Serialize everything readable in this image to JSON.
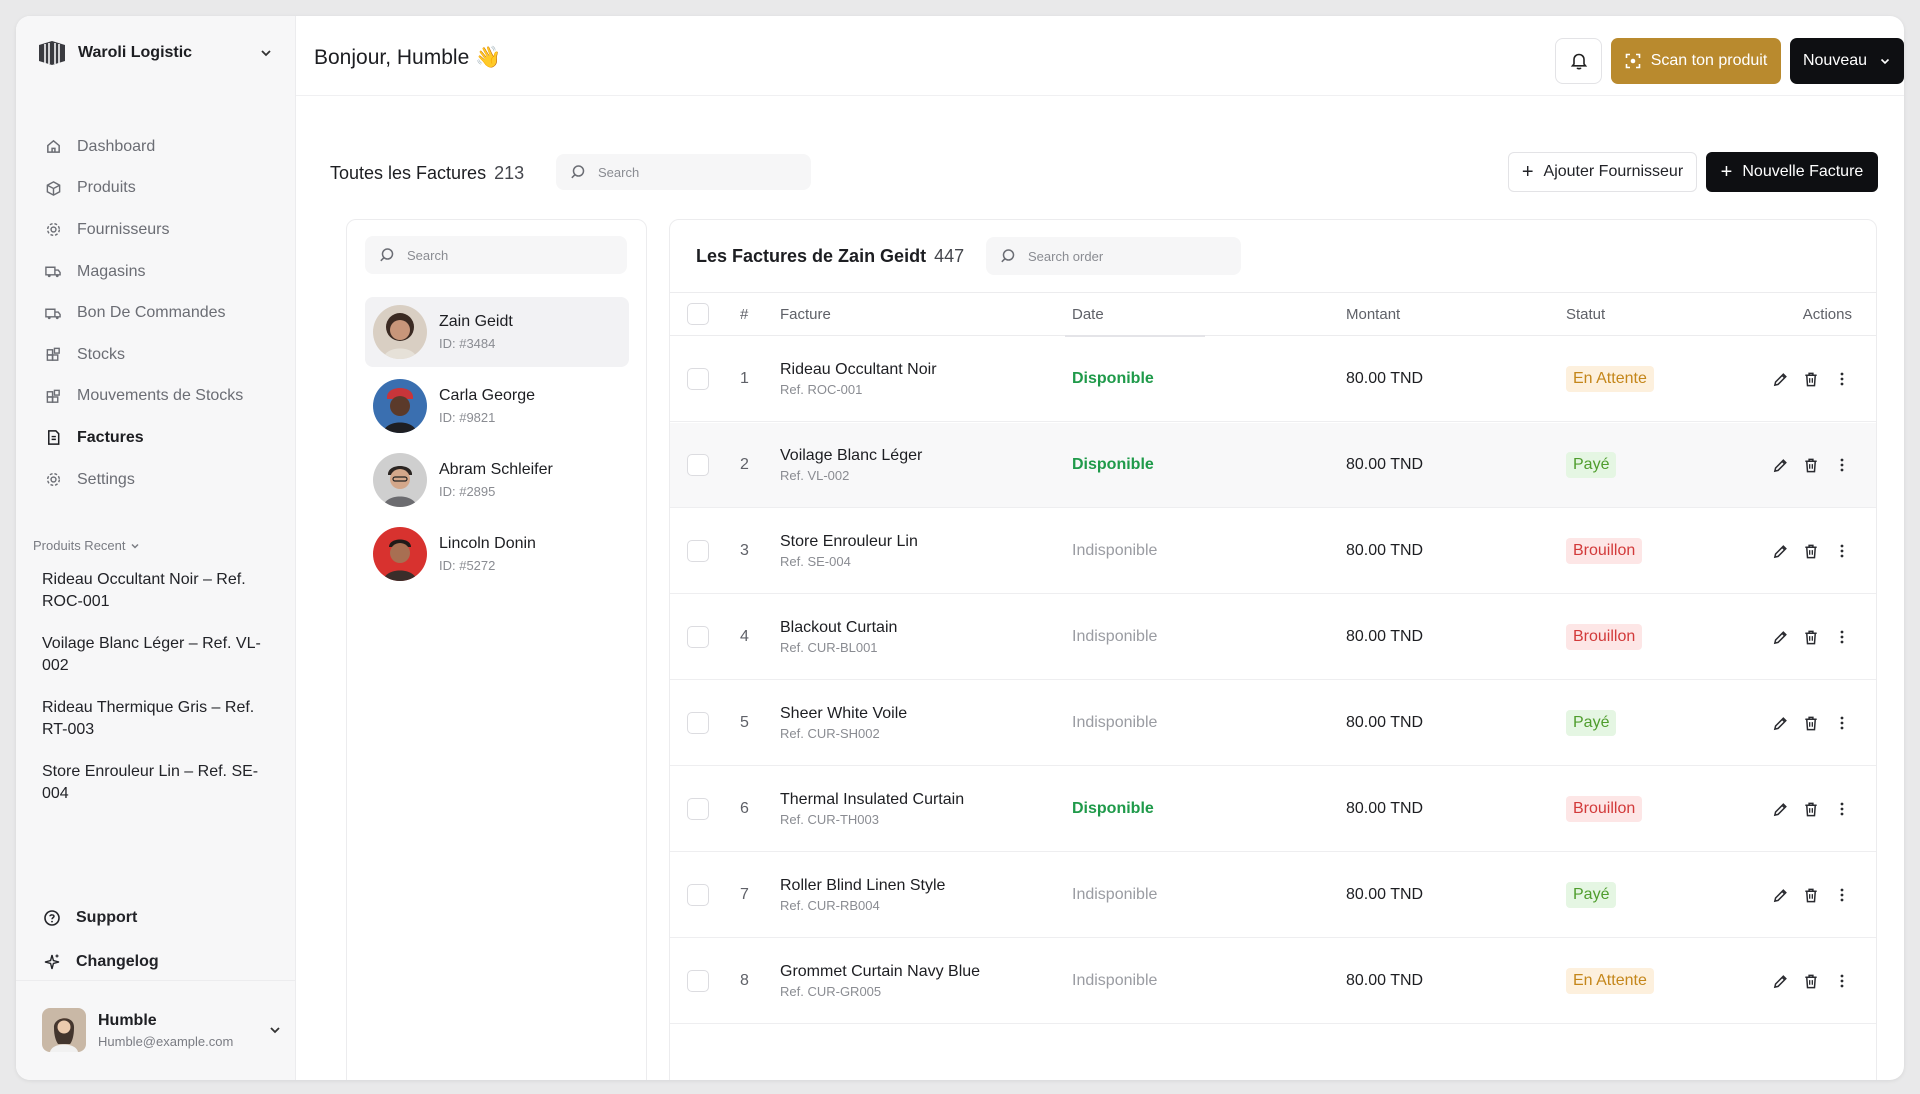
{
  "brand": {
    "name": "Waroli Logistic"
  },
  "sidebar": {
    "items": [
      {
        "label": "Dashboard",
        "icon": "home-icon",
        "active": false
      },
      {
        "label": "Produits",
        "icon": "box-icon",
        "active": false
      },
      {
        "label": "Fournisseurs",
        "icon": "gear-icon",
        "active": false
      },
      {
        "label": "Magasins",
        "icon": "truck-icon",
        "active": false
      },
      {
        "label": "Bon De Commandes",
        "icon": "truck-icon",
        "active": false
      },
      {
        "label": "Stocks",
        "icon": "grid-icon",
        "active": false
      },
      {
        "label": "Mouvements de Stocks",
        "icon": "grid-icon",
        "active": false
      },
      {
        "label": "Factures",
        "icon": "invoice-icon",
        "active": true
      },
      {
        "label": "Settings",
        "icon": "gear-icon",
        "active": false
      }
    ],
    "recent_title": "Produits Recent",
    "recent": [
      "Rideau Occultant Noir – Ref. ROC-001",
      "Voilage Blanc Léger – Ref. VL-002",
      "Rideau Thermique Gris – Ref. RT-003",
      "Store Enrouleur Lin – Ref. SE-004"
    ],
    "bottom": [
      {
        "label": "Support",
        "icon": "help-icon"
      },
      {
        "label": "Changelog",
        "icon": "sparkle-icon"
      }
    ],
    "user": {
      "name": "Humble",
      "email": "Humble@example.com"
    }
  },
  "header": {
    "greeting": "Bonjour, Humble 👋",
    "scan_label": "Scan ton produit",
    "new_label": "Nouveau"
  },
  "main": {
    "title": "Toutes les Factures",
    "count": "213",
    "search_placeholder": "Search",
    "add_supplier_label": "Ajouter Fournisseur",
    "new_invoice_label": "Nouvelle Facture"
  },
  "suppliers": {
    "search_placeholder": "Search",
    "items": [
      {
        "name": "Zain Geidt",
        "id": "ID: #3484",
        "active": true
      },
      {
        "name": "Carla George",
        "id": "ID: #9821",
        "active": false
      },
      {
        "name": "Abram Schleifer",
        "id": "ID: #2895",
        "active": false
      },
      {
        "name": "Lincoln Donin",
        "id": "ID: #5272",
        "active": false
      }
    ]
  },
  "invoices": {
    "title": "Les Factures de Zain Geidt",
    "count": "447",
    "search_placeholder": "Search order",
    "columns": [
      "#",
      "Facture",
      "Date",
      "Montant",
      "Statut",
      "Actions"
    ],
    "rows": [
      {
        "num": "1",
        "name": "Rideau Occultant Noir",
        "ref": "Ref. ROC-001",
        "date": "Disponible",
        "amount": "80.00 TND",
        "status": "En Attente"
      },
      {
        "num": "2",
        "name": "Voilage Blanc Léger",
        "ref": "Ref. VL-002",
        "date": "Disponible",
        "amount": "80.00 TND",
        "status": "Payé"
      },
      {
        "num": "3",
        "name": "Store Enrouleur Lin",
        "ref": "Ref. SE-004",
        "date": "Indisponible",
        "amount": "80.00 TND",
        "status": "Brouillon"
      },
      {
        "num": "4",
        "name": "Blackout Curtain",
        "ref": "Ref. CUR-BL001",
        "date": "Indisponible",
        "amount": "80.00 TND",
        "status": "Brouillon"
      },
      {
        "num": "5",
        "name": "Sheer White Voile",
        "ref": "Ref. CUR-SH002",
        "date": "Indisponible",
        "amount": "80.00 TND",
        "status": "Payé"
      },
      {
        "num": "6",
        "name": "Thermal Insulated Curtain",
        "ref": "Ref. CUR-TH003",
        "date": "Disponible",
        "amount": "80.00 TND",
        "status": "Brouillon"
      },
      {
        "num": "7",
        "name": "Roller Blind Linen Style",
        "ref": "Ref. CUR-RB004",
        "date": "Indisponible",
        "amount": "80.00 TND",
        "status": "Payé"
      },
      {
        "num": "8",
        "name": "Grommet Curtain Navy Blue",
        "ref": "Ref. CUR-GR005",
        "date": "Indisponible",
        "amount": "80.00 TND",
        "status": "En Attente"
      }
    ]
  },
  "colors": {
    "accent_gold": "#b98a2e",
    "primary_dark": "#0e0f12",
    "available_green": "#1f9a4a",
    "status_waiting": "#c4861a",
    "status_paid": "#4f9d2d",
    "status_draft": "#d23a3a"
  }
}
